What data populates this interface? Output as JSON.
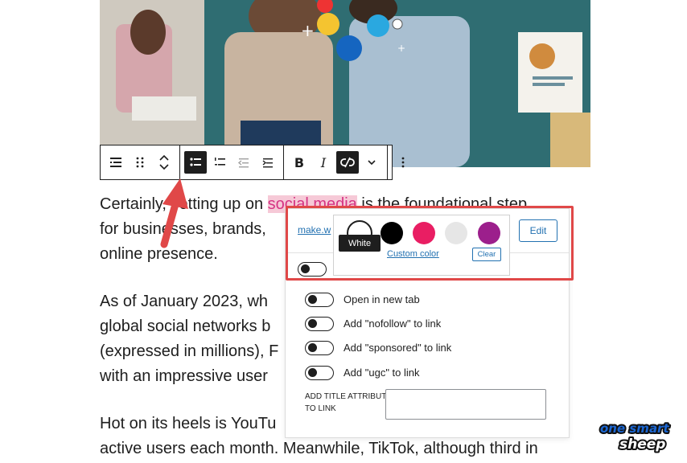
{
  "toolbar": {
    "buttons": [
      "list-view",
      "drag-handle",
      "move-up-down",
      "unordered-list",
      "ordered-list",
      "outdent",
      "indent",
      "bold",
      "italic",
      "unlink",
      "more-rich-text",
      "options"
    ]
  },
  "article": {
    "p1": {
      "line1_before": "Certainly, setting up on ",
      "highlight": "social media",
      "line1_after": " is the foundational step",
      "line2": "for businesses, brands,",
      "line3": "online presence."
    },
    "p2": {
      "line1": "As of January 2023, wh",
      "line2": "global social networks b",
      "line3": "(expressed in millions), F",
      "line4": "with an impressive user"
    },
    "p3": {
      "line1": "Hot on its heels is YouTu",
      "line2": "active users each month. Meanwhile, TikTok, although third in"
    }
  },
  "link_popover": {
    "url": "make.w",
    "edit_label": "Edit",
    "options": [
      {
        "label": "Open in new tab"
      },
      {
        "label": "Add \"nofollow\" to link"
      },
      {
        "label": "Add \"sponsored\" to link"
      },
      {
        "label": "Add \"ugc\" to link"
      }
    ],
    "title_label": "ADD TITLE ATTRIBUTE TO LINK"
  },
  "palette": {
    "swatches": [
      {
        "name": "White",
        "color": "#ffffff"
      },
      {
        "name": "Black",
        "color": "#000000"
      },
      {
        "name": "Pink",
        "color": "#e91e63"
      },
      {
        "name": "Light gray",
        "color": "#e6e6e6"
      },
      {
        "name": "Purple",
        "color": "#9c1f8c"
      }
    ],
    "tooltip": "White",
    "custom_color": "Custom color",
    "clear": "Clear"
  },
  "colors": {
    "highlight_box": "#e04848",
    "link_blue": "#2271b1",
    "text": "#1e1e1e"
  },
  "logo": {
    "line1": "one smart",
    "line2": "sheep"
  }
}
